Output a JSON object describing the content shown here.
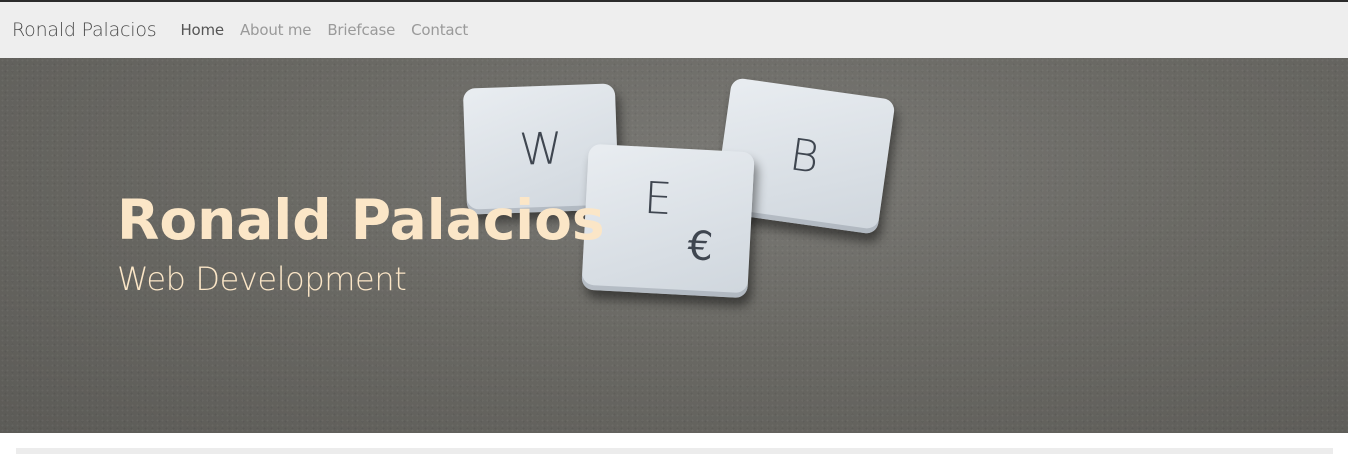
{
  "navbar": {
    "brand": "Ronald Palacios",
    "links": [
      {
        "label": "Home",
        "active": true
      },
      {
        "label": "About me",
        "active": false
      },
      {
        "label": "Briefcase",
        "active": false
      },
      {
        "label": "Contact",
        "active": false
      }
    ]
  },
  "hero": {
    "title": "Ronald Palacios",
    "subtitle": "Web Development",
    "tiles": [
      {
        "letter": "W"
      },
      {
        "letter": "B"
      },
      {
        "letter": "E",
        "symbol": "€"
      }
    ]
  },
  "colors": {
    "nav_bg": "#eeeeee",
    "hero_text": "#fbe6c7",
    "top_line": "#2b2b2b"
  }
}
